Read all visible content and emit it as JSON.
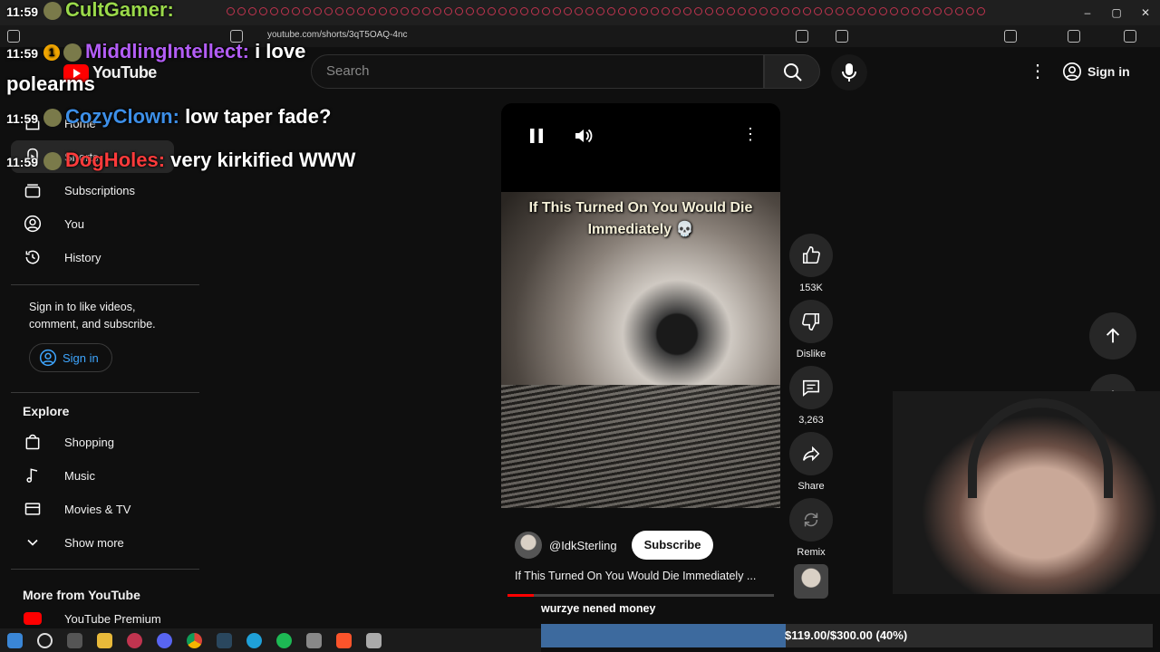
{
  "browser": {
    "url": "youtube.com/shorts/3qT5OAQ-4nc",
    "window_controls": {
      "minimize": "–",
      "maximize": "▢",
      "close": "✕"
    }
  },
  "header": {
    "logo_text": "YouTube",
    "search_placeholder": "Search",
    "more_icon": "⋮",
    "signin_label": "Sign in"
  },
  "sidebar": {
    "items": [
      {
        "label": "Home",
        "icon": "home-icon"
      },
      {
        "label": "Shorts",
        "icon": "shorts-icon"
      },
      {
        "label": "Subscriptions",
        "icon": "subscriptions-icon"
      },
      {
        "label": "You",
        "icon": "you-icon"
      },
      {
        "label": "History",
        "icon": "history-icon"
      }
    ],
    "signin_text": "Sign in to like videos, comment, and subscribe.",
    "signin_button": "Sign in",
    "explore_title": "Explore",
    "explore_items": [
      {
        "label": "Shopping",
        "icon": "shopping-icon"
      },
      {
        "label": "Music",
        "icon": "music-icon"
      },
      {
        "label": "Movies & TV",
        "icon": "movies-icon"
      },
      {
        "label": "Show more",
        "icon": "chevron-down-icon"
      }
    ],
    "more_title": "More from YouTube",
    "more_items": [
      {
        "label": "YouTube Premium"
      }
    ]
  },
  "short": {
    "caption": "If This Turned On You Would Die Immediately 💀",
    "channel": "@IdkSterling",
    "subscribe_label": "Subscribe",
    "title": "If This Turned On You Would Die Immediately ...",
    "progress": 0.1,
    "more_icon": "⋮"
  },
  "actions": {
    "like_count": "153K",
    "dislike_label": "Dislike",
    "comment_count": "3,263",
    "share_label": "Share",
    "remix_label": "Remix"
  },
  "chat": [
    {
      "time": "11:59",
      "user": "CultGamer:",
      "message": "",
      "color": "#9ad94a"
    },
    {
      "time": "11:59",
      "user": "MiddlingIntellect:",
      "message": "i love polearms",
      "color": "#b25df5",
      "badge": "1"
    },
    {
      "time": "11:59",
      "user": "CozyClown:",
      "message": "low taper fade?",
      "color": "#3d8fe8"
    },
    {
      "time": "11:59",
      "user": "DogHoles:",
      "message": "very kirkified WWW",
      "color": "#ff3b3b"
    }
  ],
  "donation": {
    "label": "wurzye nened money",
    "text": "$119.00/$300.00 (40%)",
    "raised": 119,
    "goal": 300,
    "fill_percent": 40
  },
  "colors": {
    "accent_red": "#ff0000",
    "link_blue": "#3ea6ff",
    "background": "#0f0f0f",
    "donation_fill": "#3d6a9e"
  }
}
